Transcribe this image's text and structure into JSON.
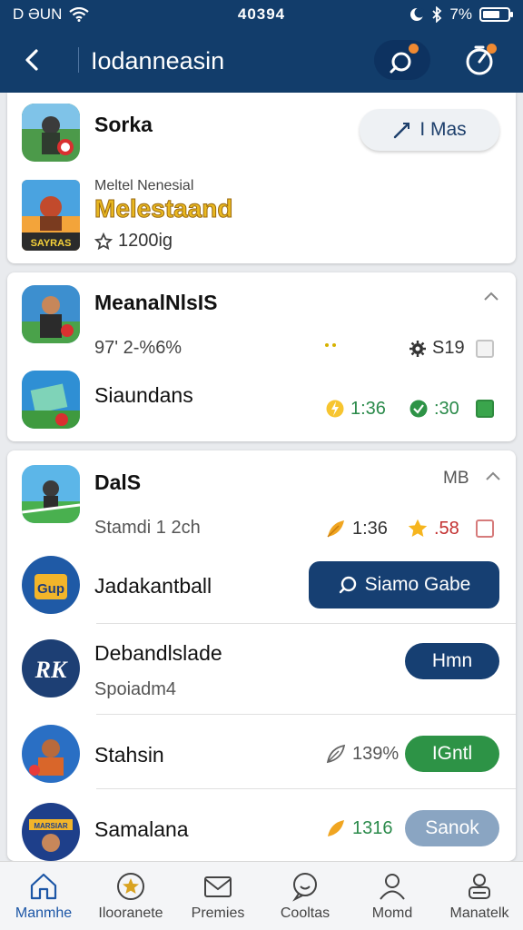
{
  "status_bar": {
    "carrier": "D ƏUN",
    "time": "40394",
    "battery": "7%",
    "battery_level": 0.7
  },
  "header": {
    "title": "Iodanneasin"
  },
  "card1": {
    "app1": {
      "name": "Sorka",
      "button": "I Mas"
    },
    "app2": {
      "caption": "Meltel Nenesial",
      "promo": "Melestaand",
      "icon_text": "SAYRAS",
      "rating": "1200ig"
    }
  },
  "card2": {
    "app1": {
      "name": "MeanalNlsIS",
      "stat": "97' 2-%6%",
      "count": "S19"
    },
    "app2": {
      "name": "Siaundans",
      "time1": "1:36",
      "time2": ":30"
    }
  },
  "card3": {
    "header_label": "MB",
    "app1": {
      "name": "DalS",
      "sub": "Stamdi 1 2ch",
      "time": "1:36",
      "score": ".58"
    },
    "app2": {
      "name": "Jadakantball",
      "icon_text": "Gup",
      "button": "Siamo Gabe"
    },
    "app3": {
      "name": "Debandlslade",
      "sub": "Spoiadm4",
      "icon_text": "RK",
      "button": "Hmn"
    },
    "app4": {
      "name": "Stahsin",
      "percent": "139%",
      "button": "IGntl"
    },
    "app5": {
      "name": "Samalana",
      "value": "1316",
      "button": "Sanok",
      "icon_text": "MARSIAR"
    }
  },
  "bottom_nav": {
    "tabs": [
      {
        "label": "Manmhe",
        "icon": "home-icon"
      },
      {
        "label": "Ilooranete",
        "icon": "star-icon"
      },
      {
        "label": "Premies",
        "icon": "mail-icon"
      },
      {
        "label": "Cooltas",
        "icon": "chat-icon"
      },
      {
        "label": "Momd",
        "icon": "user-icon"
      },
      {
        "label": "Manatelk",
        "icon": "person-icon"
      }
    ]
  },
  "colors": {
    "header": "#123d6b",
    "accent": "#f08a32",
    "green": "#2d9346",
    "navy": "#163f72"
  }
}
